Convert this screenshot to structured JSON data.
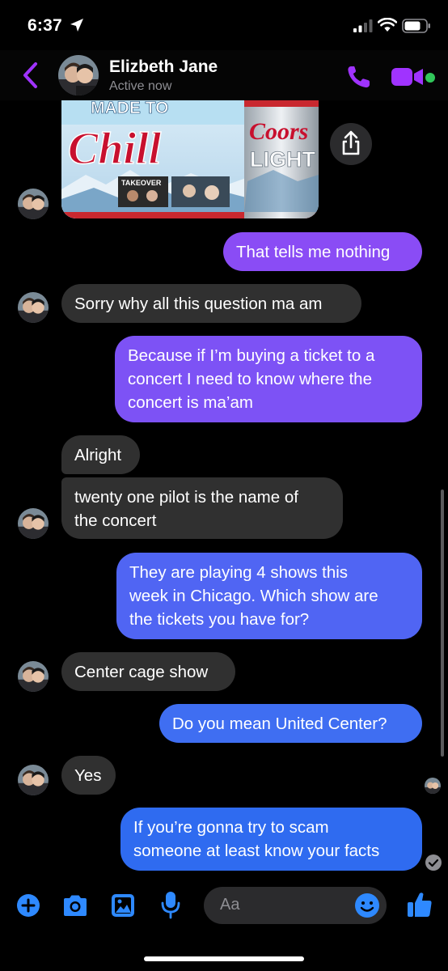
{
  "status_bar": {
    "time": "6:37"
  },
  "header": {
    "contact_name": "Elizbeth Jane",
    "contact_status": "Active now"
  },
  "image_message": {
    "text_made_to": "MADE TO",
    "text_chill": "Chill",
    "text_brand": "Coors",
    "text_light": "LIGHT",
    "text_takeover": "TAKEOVER"
  },
  "messages": [
    {
      "dir": "out",
      "lines": [
        "That tells me nothing"
      ]
    },
    {
      "dir": "in",
      "lines": [
        "Sorry why all this question ma am"
      ]
    },
    {
      "dir": "out",
      "lines": [
        "Because if I’m buying a ticket to a",
        "concert I need to know where the",
        "concert is ma’am"
      ]
    },
    {
      "dir": "in",
      "lines": [
        "Alright"
      ]
    },
    {
      "dir": "in",
      "lines": [
        "twenty one pilot is the name of",
        "the concert"
      ]
    },
    {
      "dir": "out",
      "lines": [
        "They are playing 4 shows this",
        "week in Chicago. Which show are",
        "the tickets you have for?"
      ]
    },
    {
      "dir": "in",
      "lines": [
        "Center cage show"
      ]
    },
    {
      "dir": "out",
      "lines": [
        "Do you mean United Center?"
      ]
    },
    {
      "dir": "in",
      "lines": [
        "Yes"
      ]
    },
    {
      "dir": "out",
      "lines": [
        "If you’re gonna try to scam",
        "someone at least know your facts"
      ]
    }
  ],
  "composer": {
    "placeholder": "Aa"
  },
  "colors": {
    "incoming_bubble": "#303030",
    "outgoing_gradient_top": "#8a4cf5",
    "outgoing_gradient_bottom": "#2f6bf0",
    "accent_purple": "#a033ff",
    "accent_blue": "#2e89ff",
    "online_green": "#31c75a"
  },
  "icons": {
    "status": [
      "location-arrow-icon",
      "signal-icon",
      "wifi-icon",
      "battery-icon"
    ],
    "header": [
      "back-chevron-icon",
      "phone-icon",
      "video-camera-icon"
    ],
    "composer": [
      "plus-icon",
      "camera-icon",
      "image-icon",
      "microphone-icon",
      "emoji-icon",
      "thumbs-up-icon"
    ],
    "other": [
      "share-icon",
      "seen-check-icon"
    ]
  }
}
